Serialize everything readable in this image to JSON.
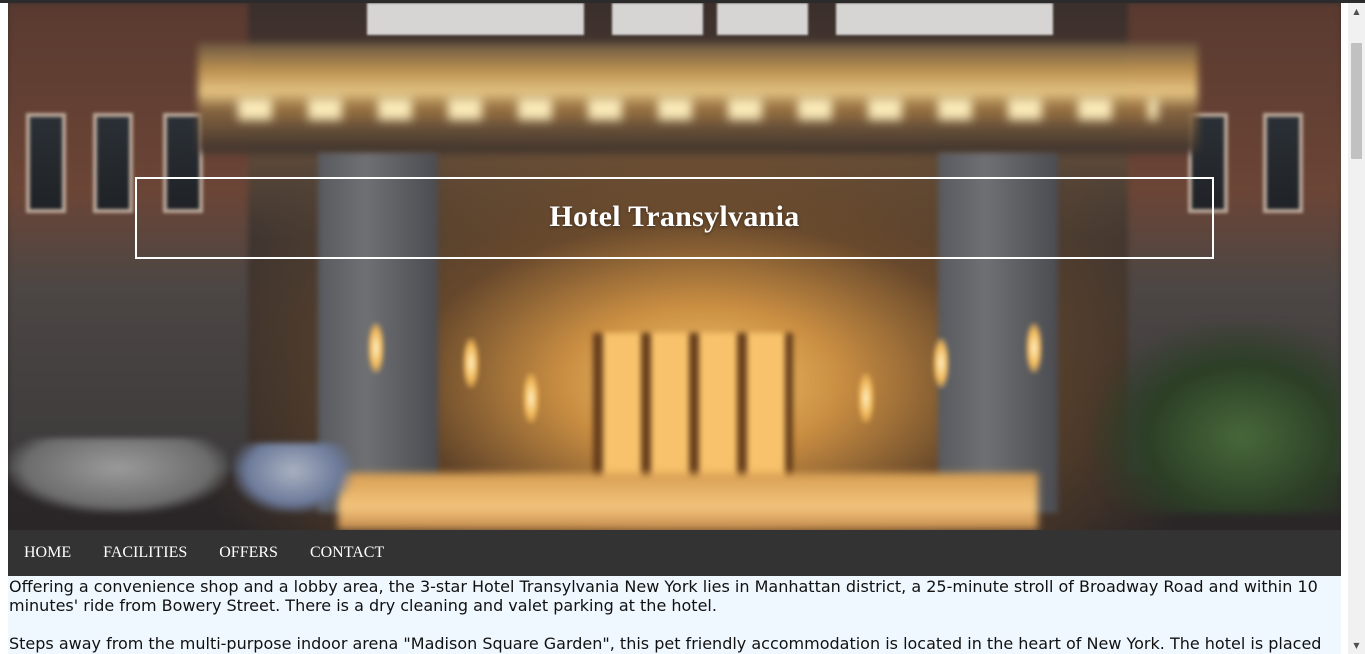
{
  "hero": {
    "title": "Hotel Transylvania"
  },
  "nav": {
    "items": [
      {
        "label": "HOME"
      },
      {
        "label": "FACILITIES"
      },
      {
        "label": "OFFERS"
      },
      {
        "label": "CONTACT"
      }
    ]
  },
  "content": {
    "paragraphs": [
      "Offering a convenience shop and a lobby area, the 3-star Hotel Transylvania New York lies in Manhattan district, a 25-minute stroll of Broadway Road and within 10 minutes' ride from Bowery Street. There is a dry cleaning and valet parking at the hotel.",
      "Steps away from the multi-purpose indoor arena \"Madison Square Garden\", this pet friendly accommodation is located in the heart of New York. The hotel is placed"
    ]
  },
  "scrollbar": {
    "up_icon": "triangle-up",
    "down_icon": "triangle-down"
  }
}
